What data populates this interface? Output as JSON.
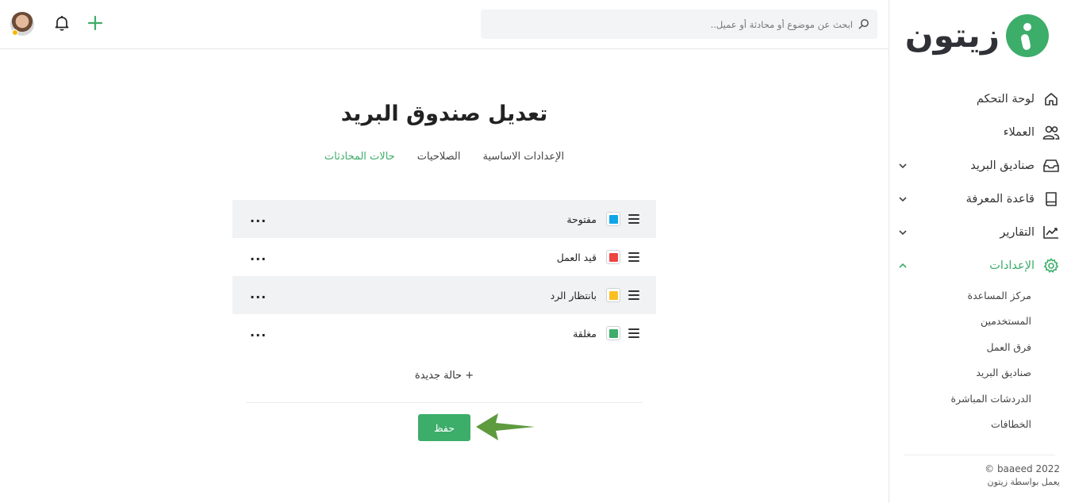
{
  "brand": {
    "logo_text": "زيتون"
  },
  "search": {
    "placeholder": "ابحث عن موضوع أو محادثة أو عميل.."
  },
  "nav": {
    "items": [
      {
        "label": "لوحة التحكم",
        "icon": "home-icon"
      },
      {
        "label": "العملاء",
        "icon": "users-icon"
      },
      {
        "label": "صناديق البريد",
        "icon": "inbox-icon"
      },
      {
        "label": "قاعدة المعرفة",
        "icon": "book-icon"
      },
      {
        "label": "التقارير",
        "icon": "chart-icon"
      },
      {
        "label": "الإعدادات",
        "icon": "gear-icon"
      }
    ],
    "settings_sub": [
      "مركز المساعدة",
      "المستخدمين",
      "فرق العمل",
      "صناديق البريد",
      "الدردشات المباشرة",
      "الخطافات"
    ]
  },
  "footer": {
    "copyright": "© baaeed 2022",
    "powered": "يعمل بواسطة زيتون"
  },
  "page": {
    "title": "تعديل صندوق البريد",
    "tabs": [
      "الإعدادات الاساسية",
      "الصلاحيات",
      "حالات المحادثات"
    ],
    "active_tab": "حالات المحادثات"
  },
  "statuses": [
    {
      "name": "مفتوحة",
      "color": "#0ea5e9"
    },
    {
      "name": "قيد العمل",
      "color": "#ef4444"
    },
    {
      "name": "بانتظار الرد",
      "color": "#fbbf24"
    },
    {
      "name": "مغلقة",
      "color": "#3dad6a"
    }
  ],
  "actions": {
    "add_status": "+ حالة جديدة",
    "save": "حفظ",
    "more": "..."
  },
  "colors": {
    "accent": "#3dad6a",
    "annotation_arrow": "#5e9a3e"
  }
}
